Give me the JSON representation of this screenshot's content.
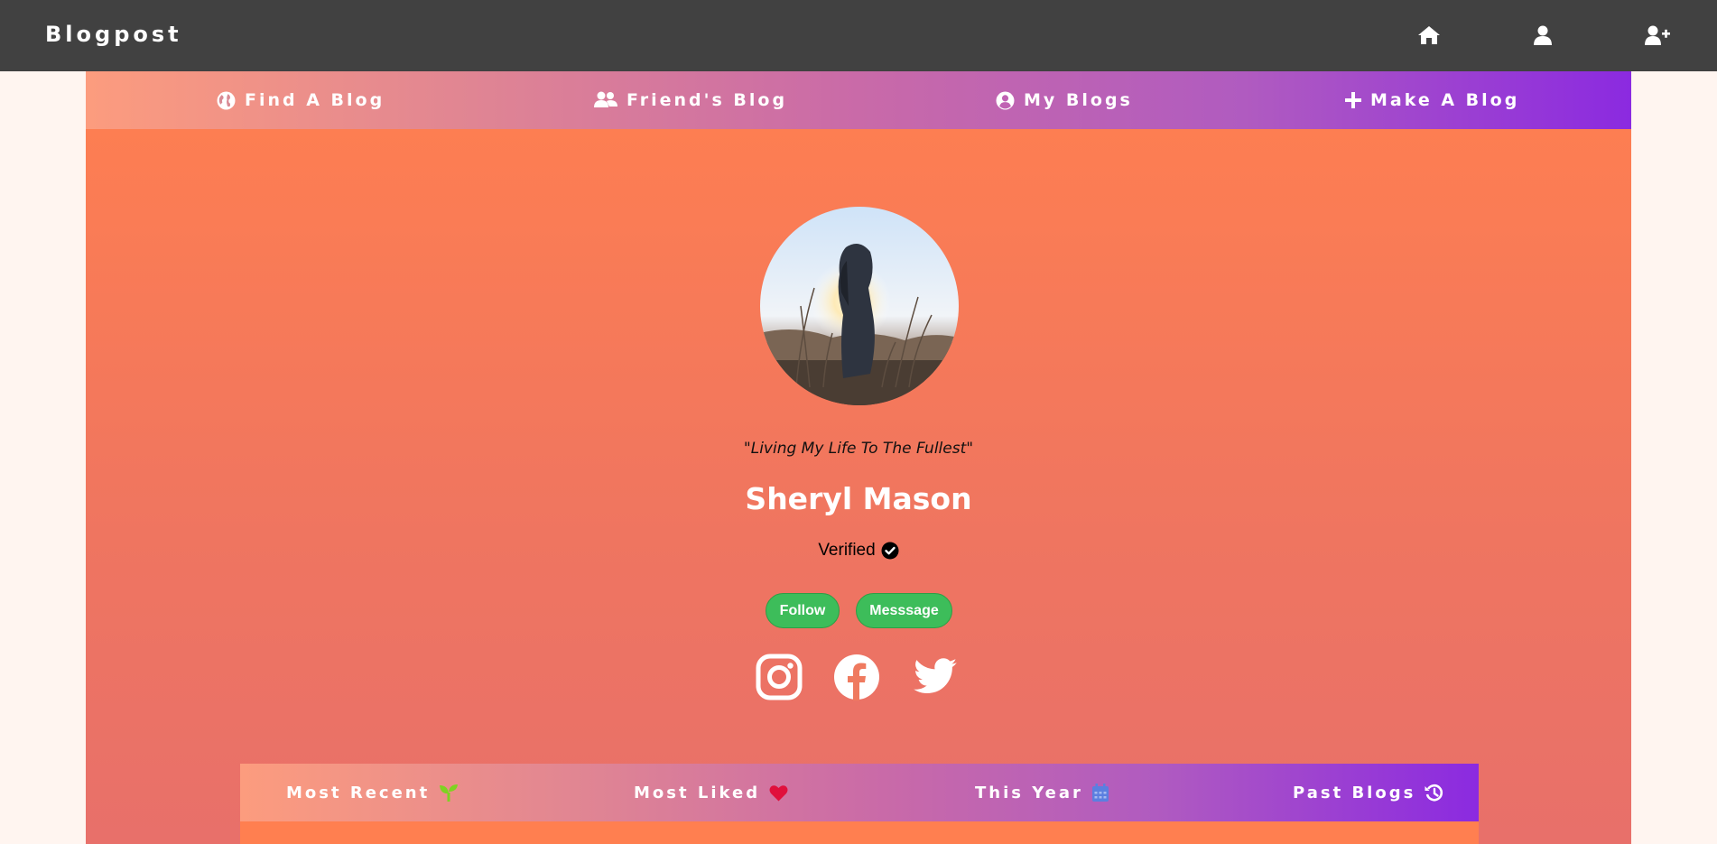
{
  "topbar": {
    "brand": "Blogpost",
    "icons": [
      "home-icon",
      "user-icon",
      "user-plus-icon"
    ]
  },
  "subnav": {
    "items": [
      {
        "label": "Find A Blog",
        "icon": "globe-icon"
      },
      {
        "label": "Friend's Blog",
        "icon": "users-icon"
      },
      {
        "label": "My Blogs",
        "icon": "user-circle-icon"
      },
      {
        "label": "Make A Blog",
        "icon": "plus-icon"
      }
    ]
  },
  "profile": {
    "quote": "\"Living My Life To The Fullest\"",
    "name": "Sheryl Mason",
    "verified_label": "Verified",
    "follow_label": "Follow",
    "message_label": "Messsage",
    "socials": [
      "instagram-icon",
      "facebook-icon",
      "twitter-icon"
    ]
  },
  "tabs": {
    "items": [
      {
        "label": "Most Recent",
        "icon": "seedling-icon",
        "icon_color": "#7ed321"
      },
      {
        "label": "Most Liked",
        "icon": "heart-icon",
        "icon_color": "#e0103c"
      },
      {
        "label": "This Year",
        "icon": "calendar-icon",
        "icon_color": "#5b7fe0"
      },
      {
        "label": "Past Blogs",
        "icon": "history-icon",
        "icon_color": "#ffffff"
      }
    ]
  },
  "colors": {
    "topbar": "#414141",
    "page_bg": "#fff5f0",
    "main_bg": "#ff7f50",
    "gradient_start": "#fc9c7e",
    "gradient_end": "#8b2ae0",
    "button_green": "#3dbd5a"
  }
}
